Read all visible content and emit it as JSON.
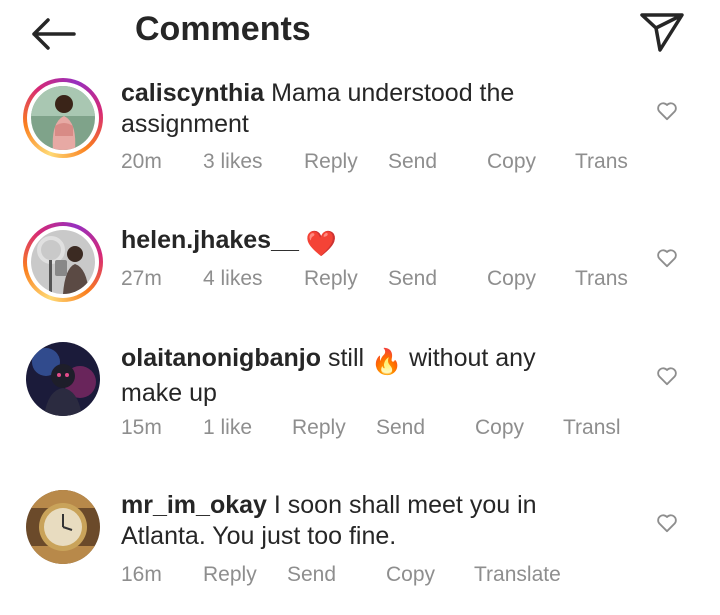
{
  "header": {
    "title": "Comments",
    "back_icon": "arrow-left-icon",
    "send_icon": "paper-plane-icon"
  },
  "comments": [
    {
      "username": "caliscynthia",
      "text": "Mama understood the assignment",
      "emoji": "",
      "time": "20m",
      "likes": "3 likes",
      "actions": {
        "reply": "Reply",
        "send": "Send",
        "copy": "Copy",
        "translate": "Trans"
      }
    },
    {
      "username": "helen.jhakes__",
      "text": "",
      "emoji": "❤️",
      "time": "27m",
      "likes": "4 likes",
      "actions": {
        "reply": "Reply",
        "send": "Send",
        "copy": "Copy",
        "translate": "Trans"
      }
    },
    {
      "username": "olaitanonigbanjo",
      "text_before": "still",
      "emoji": "🔥",
      "text_after": "without any make up",
      "time": "15m",
      "likes": "1 like",
      "actions": {
        "reply": "Reply",
        "send": "Send",
        "copy": "Copy",
        "translate": "Transl"
      }
    },
    {
      "username": "mr_im_okay",
      "text": "I soon shall meet you in Atlanta. You just too fine.",
      "time": "16m",
      "actions": {
        "reply": "Reply",
        "send": "Send",
        "copy": "Copy",
        "translate": "Translate"
      }
    }
  ],
  "colors": {
    "text": "#262626",
    "meta": "#8e8e8e",
    "heart_red": "#ed4956",
    "ring_start": "#feda75",
    "ring_end": "#962fbf"
  }
}
